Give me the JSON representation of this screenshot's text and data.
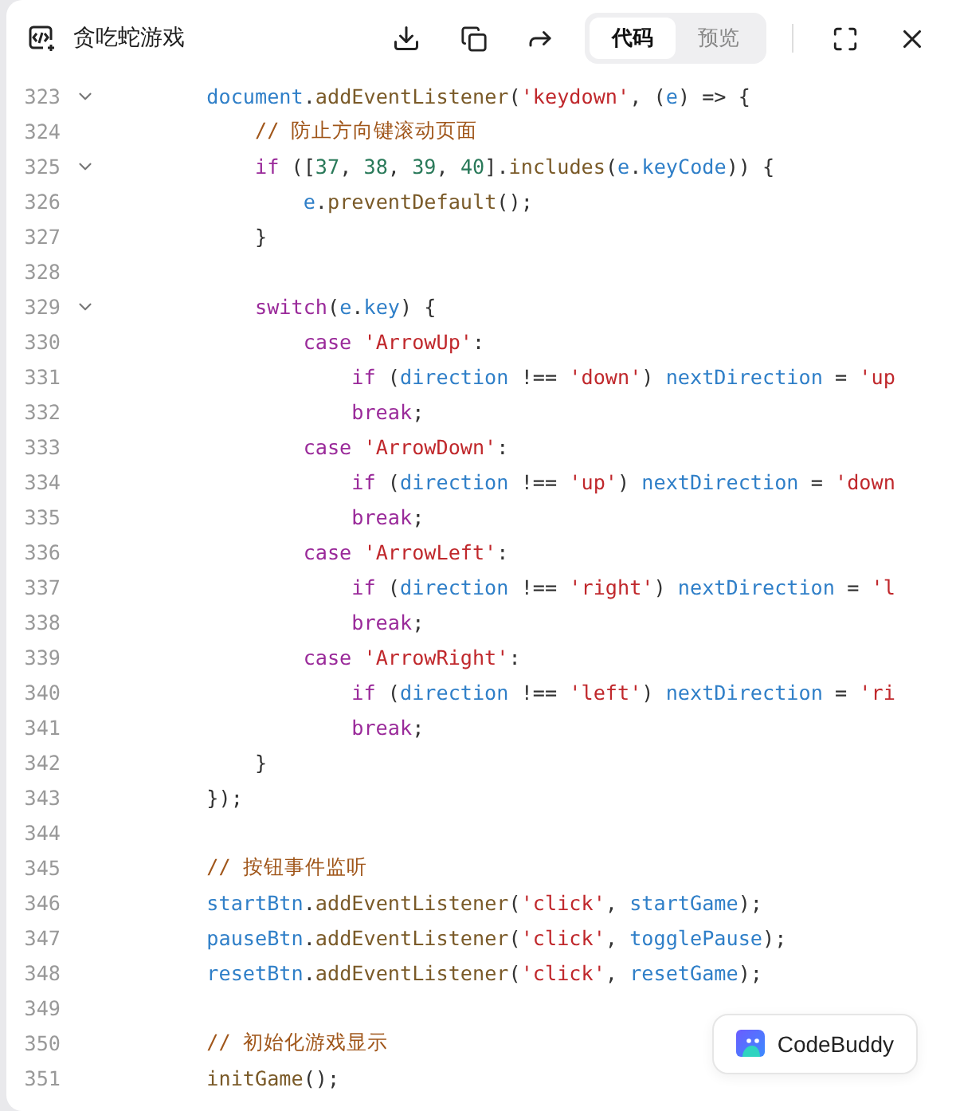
{
  "header": {
    "title": "贪吃蛇游戏",
    "tabs": [
      {
        "label": "代码",
        "selected": true
      },
      {
        "label": "预览",
        "selected": false
      }
    ]
  },
  "code": {
    "lines": [
      {
        "number": "323",
        "fold_marker": true,
        "tokens": [
          {
            "kind": "var",
            "text": "        document"
          },
          {
            "kind": "p",
            "text": "."
          },
          {
            "kind": "fn",
            "text": "addEventListener"
          },
          {
            "kind": "p",
            "text": "("
          },
          {
            "kind": "str",
            "text": "'keydown'"
          },
          {
            "kind": "p",
            "text": ", ("
          },
          {
            "kind": "var",
            "text": "e"
          },
          {
            "kind": "p",
            "text": ") => {"
          }
        ]
      },
      {
        "number": "324",
        "fold_marker": false,
        "tokens": [
          {
            "kind": "cm",
            "text": "            // 防止方向键滚动页面"
          }
        ]
      },
      {
        "number": "325",
        "fold_marker": true,
        "tokens": [
          {
            "kind": "kw",
            "text": "            if"
          },
          {
            "kind": "p",
            "text": " (["
          },
          {
            "kind": "num",
            "text": "37"
          },
          {
            "kind": "p",
            "text": ", "
          },
          {
            "kind": "num",
            "text": "38"
          },
          {
            "kind": "p",
            "text": ", "
          },
          {
            "kind": "num",
            "text": "39"
          },
          {
            "kind": "p",
            "text": ", "
          },
          {
            "kind": "num",
            "text": "40"
          },
          {
            "kind": "p",
            "text": "]."
          },
          {
            "kind": "fn",
            "text": "includes"
          },
          {
            "kind": "p",
            "text": "("
          },
          {
            "kind": "var",
            "text": "e"
          },
          {
            "kind": "p",
            "text": "."
          },
          {
            "kind": "var",
            "text": "keyCode"
          },
          {
            "kind": "p",
            "text": ")) {"
          }
        ]
      },
      {
        "number": "326",
        "fold_marker": false,
        "tokens": [
          {
            "kind": "var",
            "text": "                e"
          },
          {
            "kind": "p",
            "text": "."
          },
          {
            "kind": "fn",
            "text": "preventDefault"
          },
          {
            "kind": "p",
            "text": "();"
          }
        ]
      },
      {
        "number": "327",
        "fold_marker": false,
        "tokens": [
          {
            "kind": "p",
            "text": "            }"
          }
        ]
      },
      {
        "number": "328",
        "fold_marker": false
      },
      {
        "number": "329",
        "fold_marker": true,
        "tokens": [
          {
            "kind": "kw",
            "text": "            switch"
          },
          {
            "kind": "p",
            "text": "("
          },
          {
            "kind": "var",
            "text": "e"
          },
          {
            "kind": "p",
            "text": "."
          },
          {
            "kind": "var",
            "text": "key"
          },
          {
            "kind": "p",
            "text": ") {"
          }
        ]
      },
      {
        "number": "330",
        "fold_marker": false,
        "tokens": [
          {
            "kind": "kw",
            "text": "                case"
          },
          {
            "kind": "str",
            "text": " 'ArrowUp'"
          },
          {
            "kind": "p",
            "text": ":"
          }
        ]
      },
      {
        "number": "331",
        "fold_marker": false,
        "tokens": [
          {
            "kind": "kw",
            "text": "                    if"
          },
          {
            "kind": "p",
            "text": " ("
          },
          {
            "kind": "var",
            "text": "direction"
          },
          {
            "kind": "p",
            "text": " !== "
          },
          {
            "kind": "str",
            "text": "'down'"
          },
          {
            "kind": "p",
            "text": ") "
          },
          {
            "kind": "var",
            "text": "nextDirection"
          },
          {
            "kind": "p",
            "text": " = "
          },
          {
            "kind": "str",
            "text": "'up"
          }
        ]
      },
      {
        "number": "332",
        "fold_marker": false,
        "tokens": [
          {
            "kind": "kw",
            "text": "                    break"
          },
          {
            "kind": "p",
            "text": ";"
          }
        ]
      },
      {
        "number": "333",
        "fold_marker": false,
        "tokens": [
          {
            "kind": "kw",
            "text": "                case"
          },
          {
            "kind": "str",
            "text": " 'ArrowDown'"
          },
          {
            "kind": "p",
            "text": ":"
          }
        ]
      },
      {
        "number": "334",
        "fold_marker": false,
        "tokens": [
          {
            "kind": "kw",
            "text": "                    if"
          },
          {
            "kind": "p",
            "text": " ("
          },
          {
            "kind": "var",
            "text": "direction"
          },
          {
            "kind": "p",
            "text": " !== "
          },
          {
            "kind": "str",
            "text": "'up'"
          },
          {
            "kind": "p",
            "text": ") "
          },
          {
            "kind": "var",
            "text": "nextDirection"
          },
          {
            "kind": "p",
            "text": " = "
          },
          {
            "kind": "str",
            "text": "'down"
          }
        ]
      },
      {
        "number": "335",
        "fold_marker": false,
        "tokens": [
          {
            "kind": "kw",
            "text": "                    break"
          },
          {
            "kind": "p",
            "text": ";"
          }
        ]
      },
      {
        "number": "336",
        "fold_marker": false,
        "tokens": [
          {
            "kind": "kw",
            "text": "                case"
          },
          {
            "kind": "str",
            "text": " 'ArrowLeft'"
          },
          {
            "kind": "p",
            "text": ":"
          }
        ]
      },
      {
        "number": "337",
        "fold_marker": false,
        "tokens": [
          {
            "kind": "kw",
            "text": "                    if"
          },
          {
            "kind": "p",
            "text": " ("
          },
          {
            "kind": "var",
            "text": "direction"
          },
          {
            "kind": "p",
            "text": " !== "
          },
          {
            "kind": "str",
            "text": "'right'"
          },
          {
            "kind": "p",
            "text": ") "
          },
          {
            "kind": "var",
            "text": "nextDirection"
          },
          {
            "kind": "p",
            "text": " = "
          },
          {
            "kind": "str",
            "text": "'l"
          }
        ]
      },
      {
        "number": "338",
        "fold_marker": false,
        "tokens": [
          {
            "kind": "kw",
            "text": "                    break"
          },
          {
            "kind": "p",
            "text": ";"
          }
        ]
      },
      {
        "number": "339",
        "fold_marker": false,
        "tokens": [
          {
            "kind": "kw",
            "text": "                case"
          },
          {
            "kind": "str",
            "text": " 'ArrowRight'"
          },
          {
            "kind": "p",
            "text": ":"
          }
        ]
      },
      {
        "number": "340",
        "fold_marker": false,
        "tokens": [
          {
            "kind": "kw",
            "text": "                    if"
          },
          {
            "kind": "p",
            "text": " ("
          },
          {
            "kind": "var",
            "text": "direction"
          },
          {
            "kind": "p",
            "text": " !== "
          },
          {
            "kind": "str",
            "text": "'left'"
          },
          {
            "kind": "p",
            "text": ") "
          },
          {
            "kind": "var",
            "text": "nextDirection"
          },
          {
            "kind": "p",
            "text": " = "
          },
          {
            "kind": "str",
            "text": "'ri"
          }
        ]
      },
      {
        "number": "341",
        "fold_marker": false,
        "tokens": [
          {
            "kind": "kw",
            "text": "                    break"
          },
          {
            "kind": "p",
            "text": ";"
          }
        ]
      },
      {
        "number": "342",
        "fold_marker": false,
        "tokens": [
          {
            "kind": "p",
            "text": "            }"
          }
        ]
      },
      {
        "number": "343",
        "fold_marker": false,
        "tokens": [
          {
            "kind": "p",
            "text": "        });"
          }
        ]
      },
      {
        "number": "344",
        "fold_marker": false
      },
      {
        "number": "345",
        "fold_marker": false,
        "tokens": [
          {
            "kind": "cm",
            "text": "        // 按钮事件监听"
          }
        ]
      },
      {
        "number": "346",
        "fold_marker": false,
        "tokens": [
          {
            "kind": "var",
            "text": "        startBtn"
          },
          {
            "kind": "p",
            "text": "."
          },
          {
            "kind": "fn",
            "text": "addEventListener"
          },
          {
            "kind": "p",
            "text": "("
          },
          {
            "kind": "str",
            "text": "'click'"
          },
          {
            "kind": "p",
            "text": ", "
          },
          {
            "kind": "var",
            "text": "startGame"
          },
          {
            "kind": "p",
            "text": ");"
          }
        ]
      },
      {
        "number": "347",
        "fold_marker": false,
        "tokens": [
          {
            "kind": "var",
            "text": "        pauseBtn"
          },
          {
            "kind": "p",
            "text": "."
          },
          {
            "kind": "fn",
            "text": "addEventListener"
          },
          {
            "kind": "p",
            "text": "("
          },
          {
            "kind": "str",
            "text": "'click'"
          },
          {
            "kind": "p",
            "text": ", "
          },
          {
            "kind": "var",
            "text": "togglePause"
          },
          {
            "kind": "p",
            "text": ");"
          }
        ]
      },
      {
        "number": "348",
        "fold_marker": false,
        "tokens": [
          {
            "kind": "var",
            "text": "        resetBtn"
          },
          {
            "kind": "p",
            "text": "."
          },
          {
            "kind": "fn",
            "text": "addEventListener"
          },
          {
            "kind": "p",
            "text": "("
          },
          {
            "kind": "str",
            "text": "'click'"
          },
          {
            "kind": "p",
            "text": ", "
          },
          {
            "kind": "var",
            "text": "resetGame"
          },
          {
            "kind": "p",
            "text": ");"
          }
        ]
      },
      {
        "number": "349",
        "fold_marker": false
      },
      {
        "number": "350",
        "fold_marker": false,
        "tokens": [
          {
            "kind": "cm",
            "text": "        // 初始化游戏显示"
          }
        ]
      },
      {
        "number": "351",
        "fold_marker": false,
        "tokens": [
          {
            "kind": "fn",
            "text": "        initGame"
          },
          {
            "kind": "p",
            "text": "();"
          }
        ]
      }
    ]
  },
  "assistant_button": {
    "label": "CodeBuddy"
  }
}
